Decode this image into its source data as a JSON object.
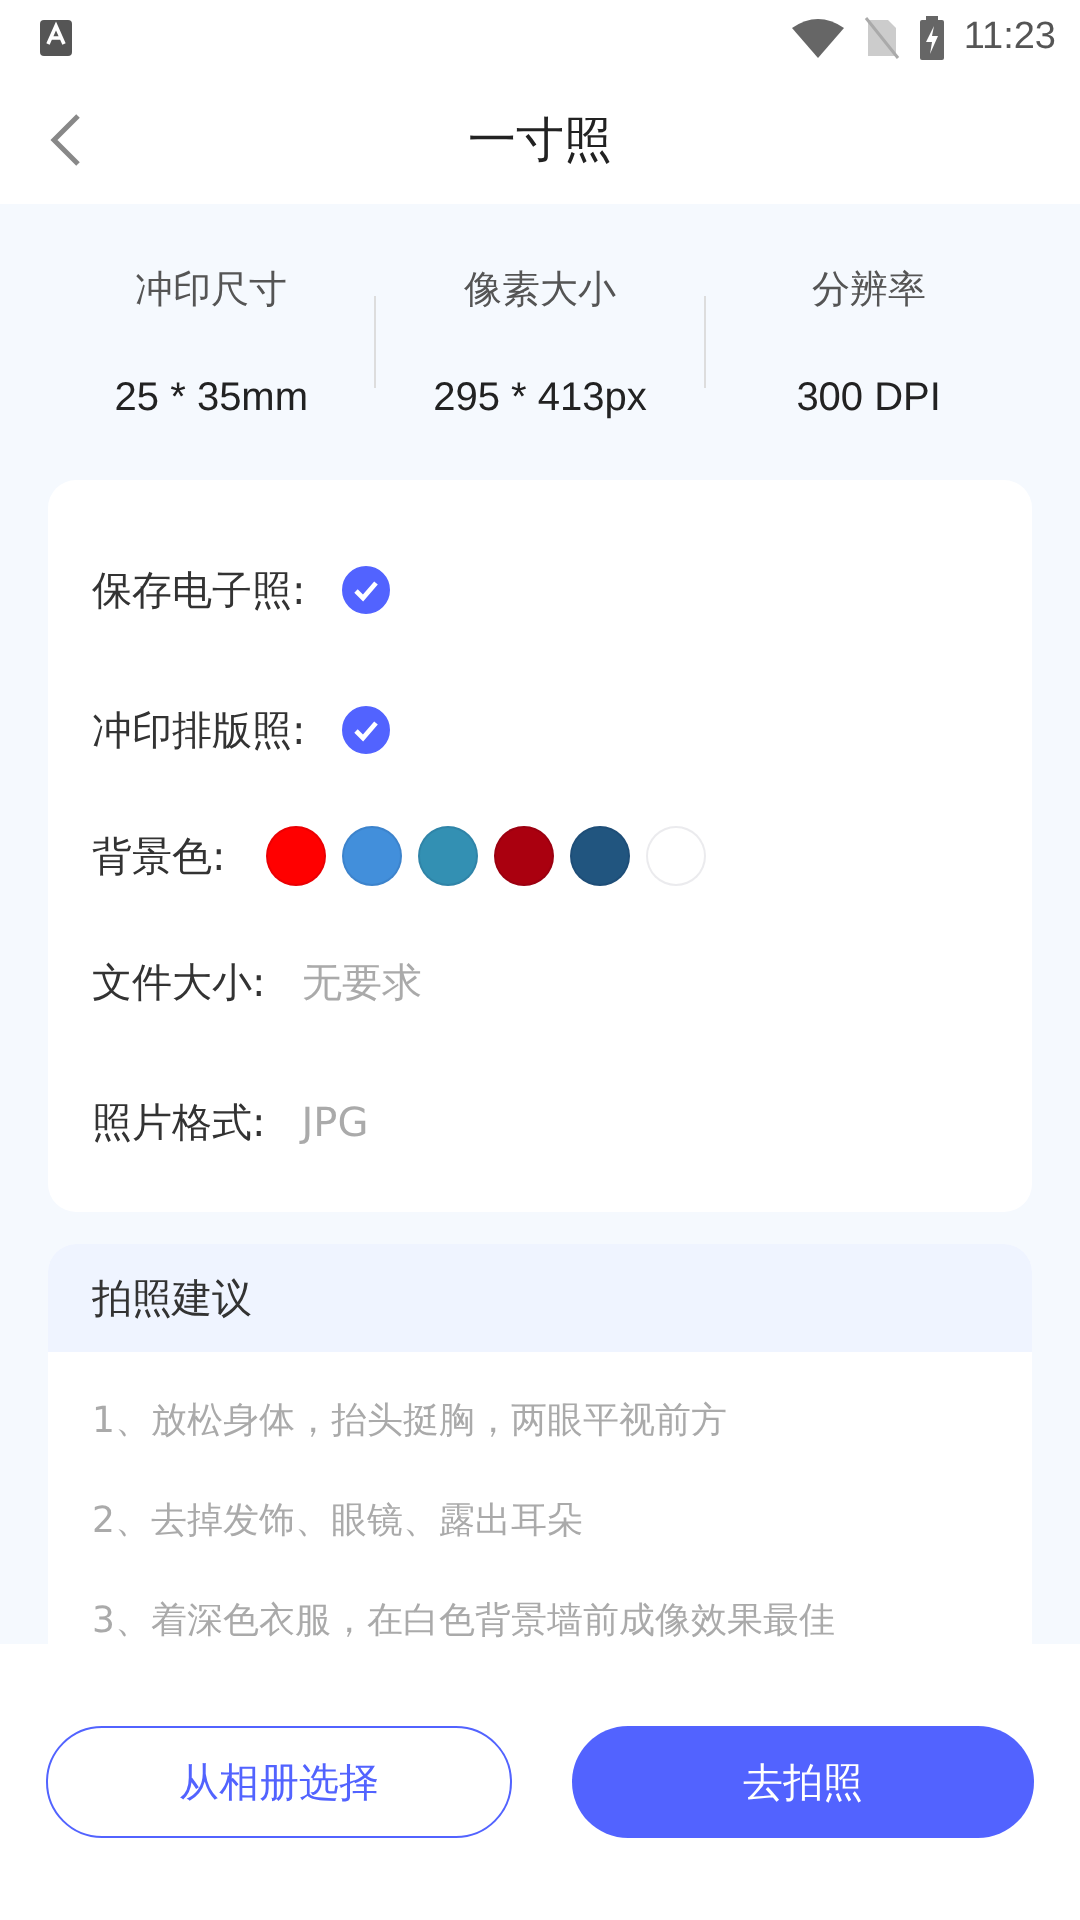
{
  "status_bar": {
    "time": "11:23"
  },
  "header": {
    "title": "一寸照"
  },
  "specs": [
    {
      "label": "冲印尺寸",
      "value": "25 * 35mm"
    },
    {
      "label": "像素大小",
      "value": "295 * 413px"
    },
    {
      "label": "分辨率",
      "value": "300 DPI"
    }
  ],
  "options": [
    {
      "kind": "check",
      "label": "保存电子照:",
      "checked": true
    },
    {
      "kind": "check",
      "label": "冲印排版照:",
      "checked": true
    },
    {
      "kind": "colors",
      "label": "背景色:",
      "colors": [
        {
          "color": "#ff0000"
        },
        {
          "color": "#428fdb"
        },
        {
          "color": "#3390b3"
        },
        {
          "color": "#aa000f"
        },
        {
          "color": "#21557f"
        },
        {
          "color": "#ffffff"
        }
      ]
    },
    {
      "kind": "text",
      "label": "文件大小:",
      "value": "无要求"
    },
    {
      "kind": "text",
      "label": "照片格式:",
      "value": "JPG"
    }
  ],
  "tips": {
    "title": "拍照建议",
    "items": [
      "1、放松身体，抬头挺胸，两眼平视前方",
      "2、去掉发饰、眼镜、露出耳朵",
      "3、着深色衣服，在白色背景墙前成像效果最佳"
    ]
  },
  "buttons": [
    {
      "label": "从相册选择",
      "kind": "outline"
    },
    {
      "label": "去拍照",
      "kind": "primary"
    }
  ]
}
